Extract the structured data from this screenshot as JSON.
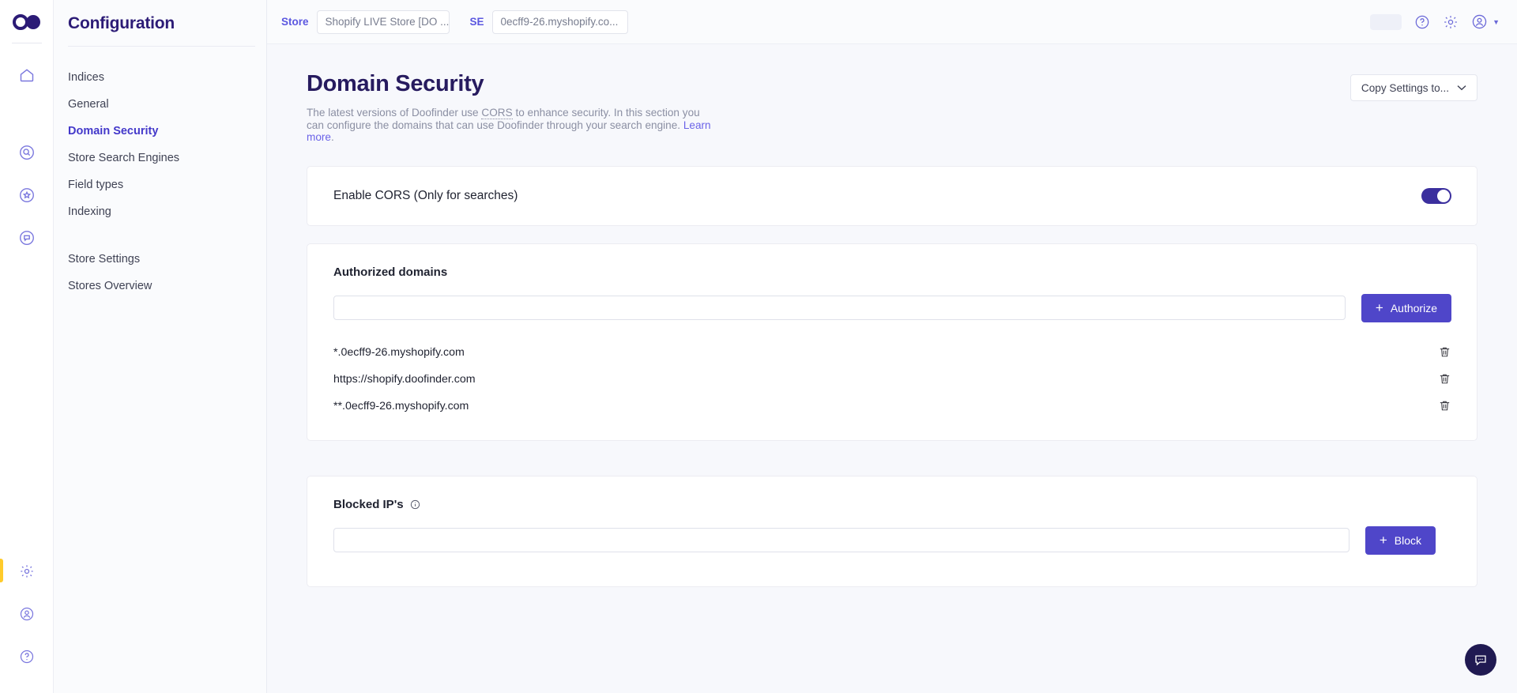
{
  "rail": {
    "logo": "doofinder-logo",
    "items": [
      {
        "name": "home-icon",
        "label": "Home"
      },
      {
        "name": "search-icon",
        "label": "Search"
      },
      {
        "name": "star-icon",
        "label": "Favorites"
      },
      {
        "name": "chat-icon",
        "label": "Messages"
      }
    ],
    "bottom": [
      {
        "name": "gear-icon",
        "label": "Settings",
        "active": true
      },
      {
        "name": "user-icon",
        "label": "Account",
        "active": false
      },
      {
        "name": "help-icon",
        "label": "Help",
        "active": false
      }
    ]
  },
  "sidebar": {
    "title": "Configuration",
    "items": [
      {
        "label": "Indices",
        "current": false
      },
      {
        "label": "General",
        "current": false
      },
      {
        "label": "Domain Security",
        "current": true
      },
      {
        "label": "Store Search Engines",
        "current": false
      },
      {
        "label": "Field types",
        "current": false
      },
      {
        "label": "Indexing",
        "current": false
      }
    ],
    "items2": [
      {
        "label": "Store Settings",
        "current": false
      },
      {
        "label": "Stores Overview",
        "current": false
      }
    ]
  },
  "topbar": {
    "store_label": "Store",
    "store_value": "Shopify LIVE Store [DO ...",
    "se_label": "SE",
    "se_value": "0ecff9-26.myshopify.co...",
    "help_icon": "help-circle-icon",
    "settings_icon": "gear-icon",
    "account_icon": "user-circle-icon",
    "account_caret": "▼"
  },
  "page": {
    "title": "Domain Security",
    "desc_part1": "The latest versions of Doofinder use ",
    "desc_abbr": "CORS",
    "desc_part2": " to enhance security. In this section you can configure the domains that can use Doofinder through your search engine. ",
    "desc_link": "Learn more",
    "desc_end": ".",
    "copy_settings_label": "Copy Settings to...",
    "copy_settings_caret": "⌄"
  },
  "cors": {
    "label": "Enable CORS (Only for searches)",
    "enabled": true,
    "accent": "#3b2f9e"
  },
  "authorized": {
    "title": "Authorized domains",
    "input_value": "",
    "input_placeholder": "",
    "button_label": "Authorize",
    "button_plus": "+",
    "domains": [
      "*.0ecff9-26.myshopify.com",
      "https://shopify.doofinder.com",
      "**.0ecff9-26.myshopify.com"
    ],
    "delete_icon": "trash-icon"
  },
  "blocked": {
    "title": "Blocked IP's",
    "info_icon": "info-icon",
    "input_value": "",
    "input_placeholder": "",
    "button_label": "Block",
    "button_plus": "+"
  },
  "fab": {
    "icon": "chat-bubble-icon",
    "color": "#201a52"
  }
}
